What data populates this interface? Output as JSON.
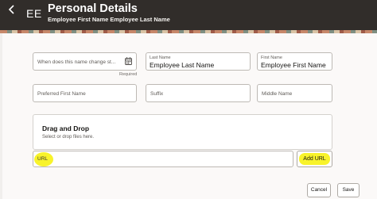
{
  "header": {
    "initials": "EE",
    "title": "Personal Details",
    "subtitle": "Employee First Name Employee Last Name"
  },
  "form": {
    "name_change_date": {
      "placeholder": "When does this name change st...",
      "required_note": "Required"
    },
    "last_name": {
      "label": "Last Name",
      "value": "Employee Last Name"
    },
    "first_name": {
      "label": "First Name",
      "value": "Employee First Name"
    },
    "preferred_first_name": {
      "placeholder": "Preferred First Name"
    },
    "suffix": {
      "placeholder": "Suffix"
    },
    "middle_name": {
      "placeholder": "Middle Name"
    }
  },
  "attachments": {
    "title": "Drag and Drop",
    "hint": "Select or drop files here.",
    "url_label": "URL",
    "add_url_label": "Add URL"
  },
  "footer": {
    "cancel_label": "Cancel",
    "save_label": "Save"
  },
  "colors": {
    "header_bg": "#312d2a",
    "highlight": "#f8f32b"
  }
}
